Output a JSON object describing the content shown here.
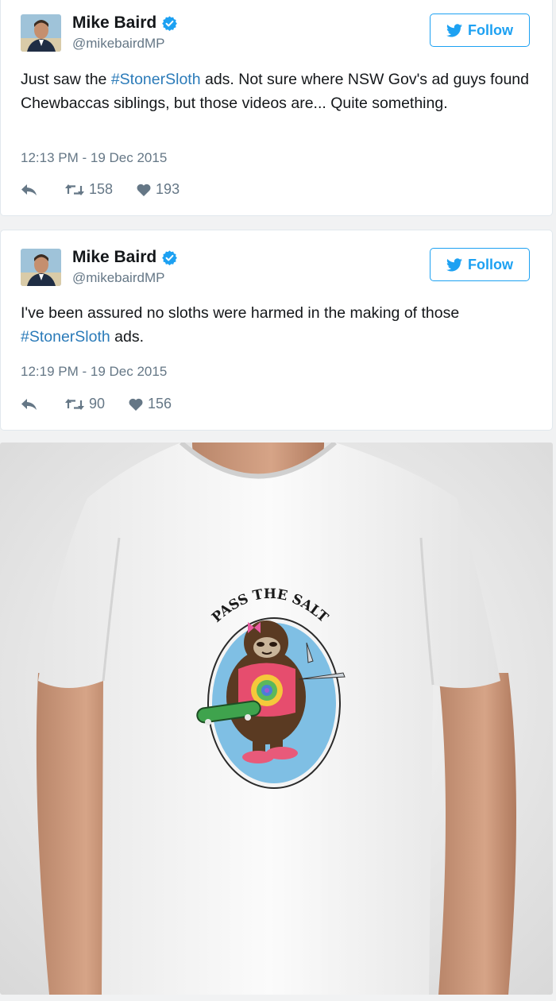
{
  "tweets": [
    {
      "name": "Mike Baird",
      "handle": "@mikebairdMP",
      "follow_label": "Follow",
      "text_before": "Just saw the ",
      "hashtag": "#StonerSloth",
      "text_after": " ads. Not sure where NSW Gov's ad guys found Chewbaccas siblings, but those videos are... Quite something.",
      "timestamp": "12:13 PM - 19 Dec 2015",
      "retweets": "158",
      "likes": "193"
    },
    {
      "name": "Mike Baird",
      "handle": "@mikebairdMP",
      "follow_label": "Follow",
      "text_before": "I've been assured no sloths were harmed in the making of those ",
      "hashtag": "#StonerSloth",
      "text_after": " ads.",
      "timestamp": "12:19 PM - 19 Dec 2015",
      "retweets": "90",
      "likes": "156"
    }
  ],
  "photo": {
    "shirt_text": "PASS THE SALT",
    "badge_colors": {
      "oval": "#7fbfe4",
      "shirt": "#f4f4f4",
      "sloth": "#5a3a22"
    }
  },
  "colors": {
    "brand": "#1da1f2",
    "hashtag": "#2b7bb9",
    "meta": "#657786"
  }
}
